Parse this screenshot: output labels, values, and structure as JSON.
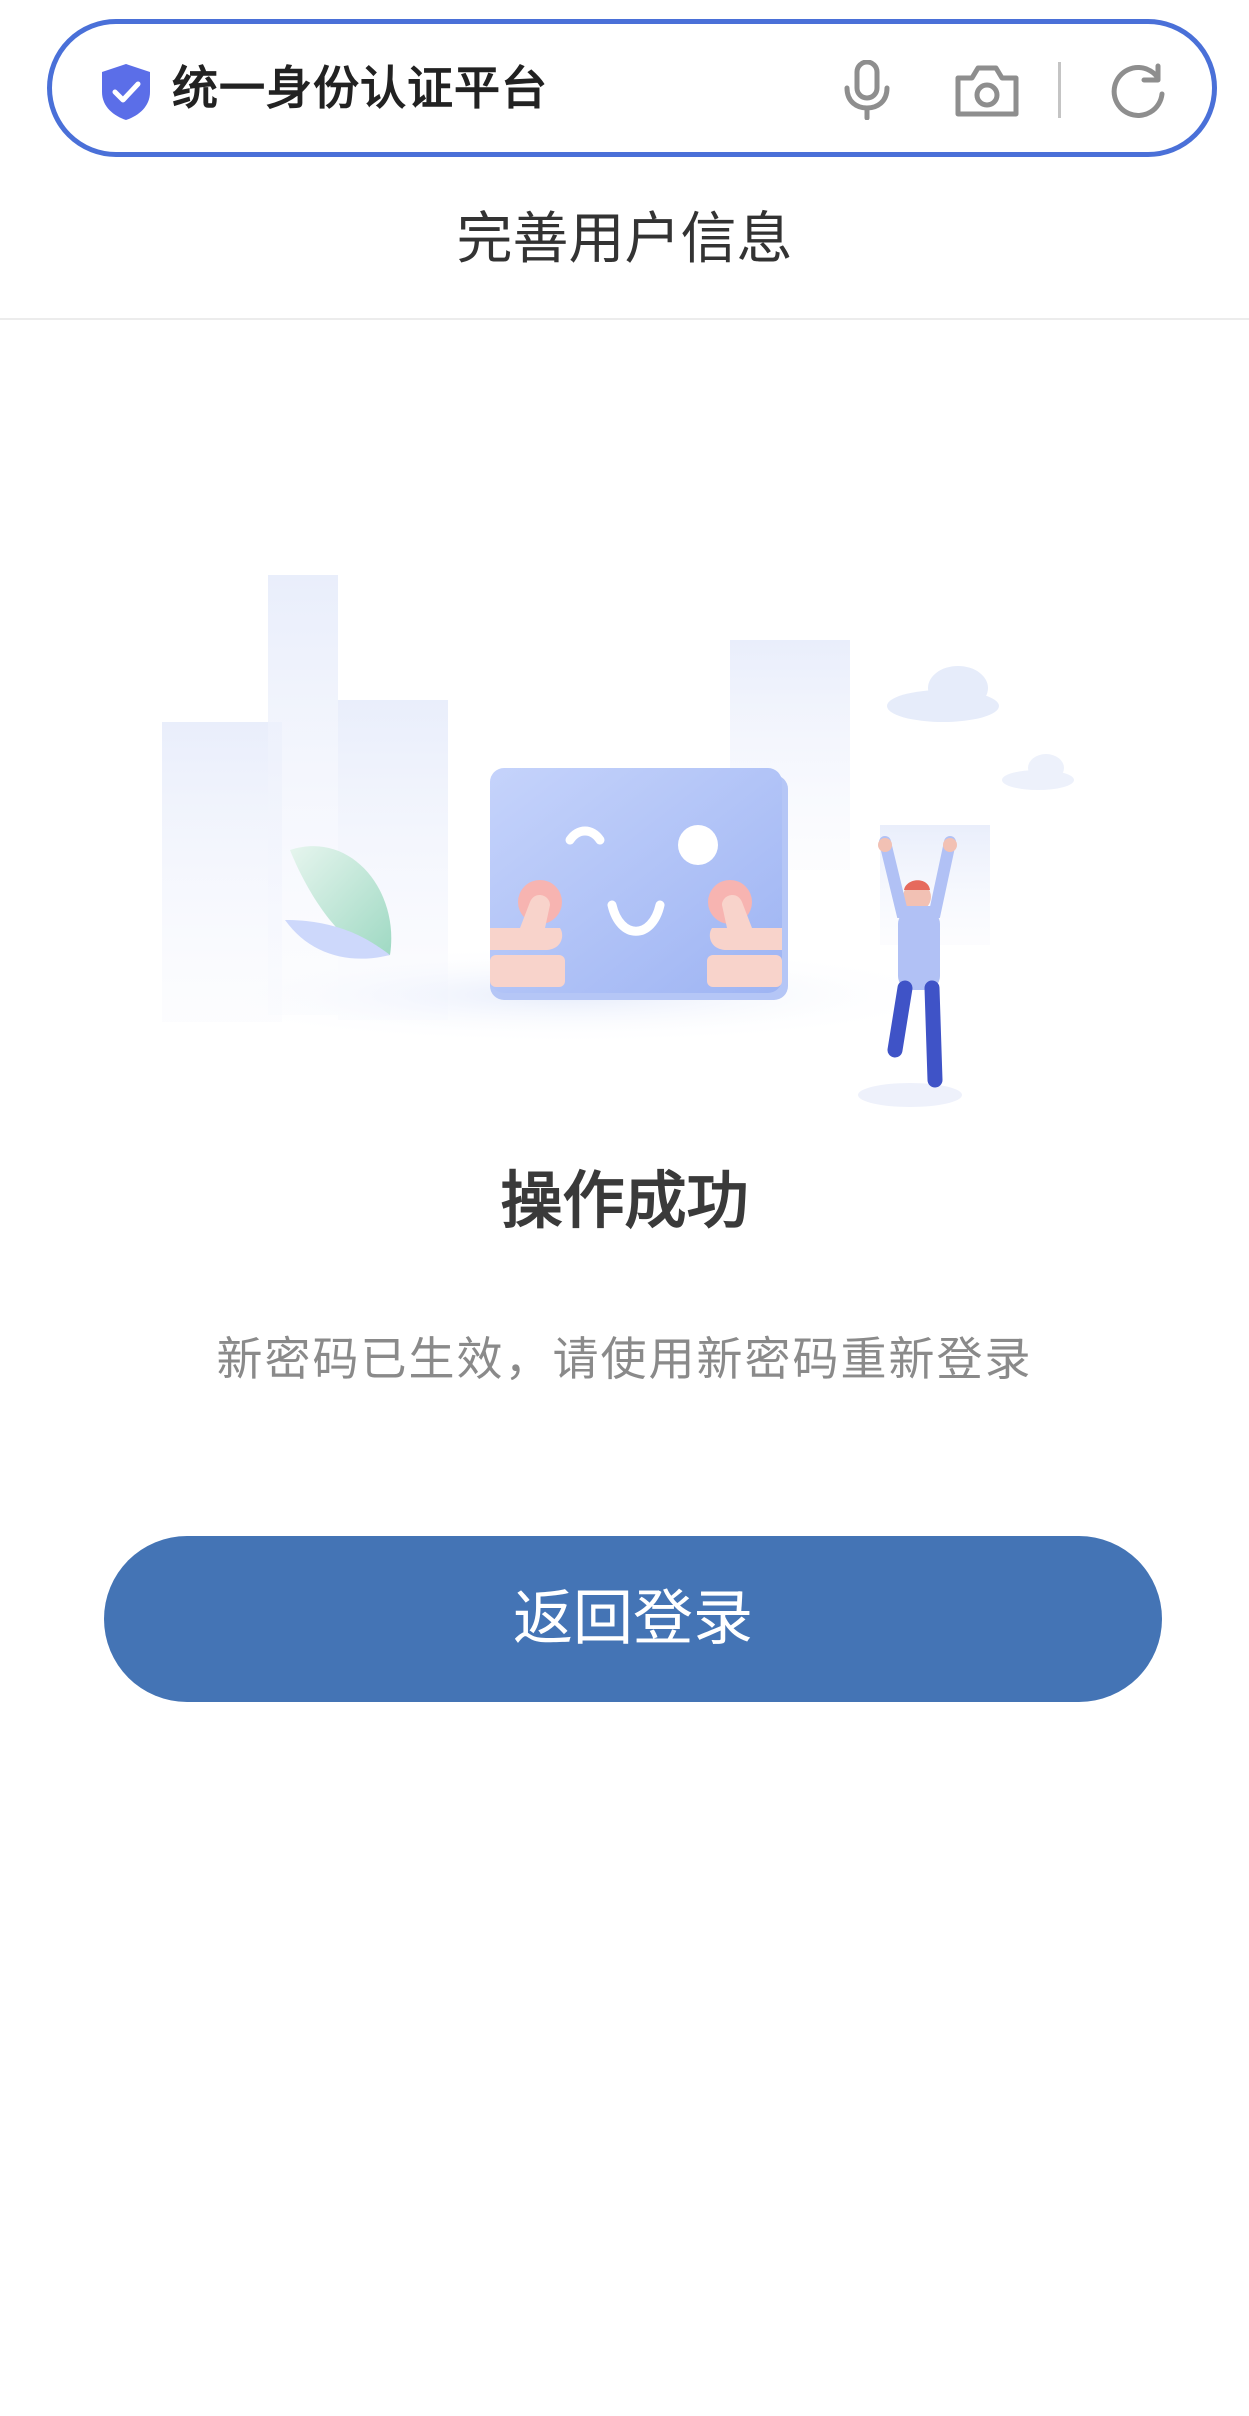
{
  "browser": {
    "site_title": "统一身份认证平台",
    "icons": [
      "shield-check-icon",
      "microphone-icon",
      "camera-icon",
      "refresh-icon"
    ]
  },
  "header": {
    "title": "完善用户信息"
  },
  "result": {
    "title": "操作成功",
    "message": "新密码已生效，请使用新密码重新登录"
  },
  "actions": {
    "back_login_label": "返回登录"
  },
  "colors": {
    "accent": "#4474b5",
    "addressbar_border": "#4a70d8",
    "shield": "#5b6ee8"
  }
}
